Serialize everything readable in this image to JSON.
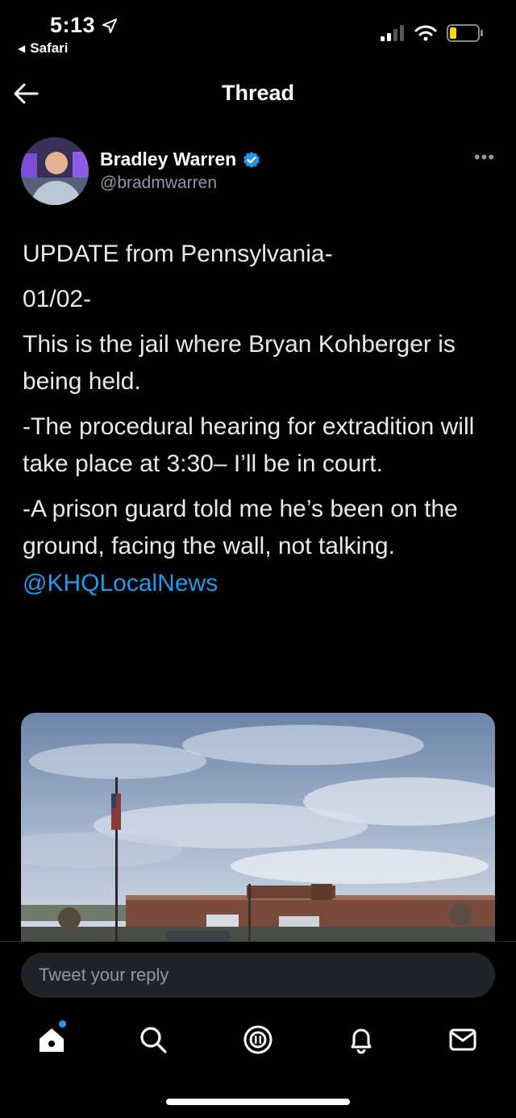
{
  "status_bar": {
    "time": "5:13",
    "back_app": "Safari"
  },
  "header": {
    "title": "Thread"
  },
  "author": {
    "name": "Bradley Warren",
    "handle": "@bradmwarren"
  },
  "tweet": {
    "lines": [
      "UPDATE from Pennsylvania-",
      "01/02-",
      "This is the jail where Bryan Kohberger is being held.",
      "-The procedural hearing for extradition will take place at 3:30– I’ll be in court.",
      "-A prison guard told me he’s been on the ground, facing the wall, not talking."
    ],
    "mention": "@KHQLocalNews"
  },
  "reply": {
    "placeholder": "Tweet your reply"
  },
  "colors": {
    "accent": "#1d9bf0",
    "background": "#000000",
    "secondary_text": "#8b98a5"
  },
  "icons": [
    "location-arrow-icon",
    "signal-icon",
    "wifi-icon",
    "battery-icon",
    "back-arrow-icon",
    "verified-badge-icon",
    "more-icon",
    "home-icon",
    "search-icon",
    "spaces-icon",
    "notifications-icon",
    "messages-icon"
  ]
}
